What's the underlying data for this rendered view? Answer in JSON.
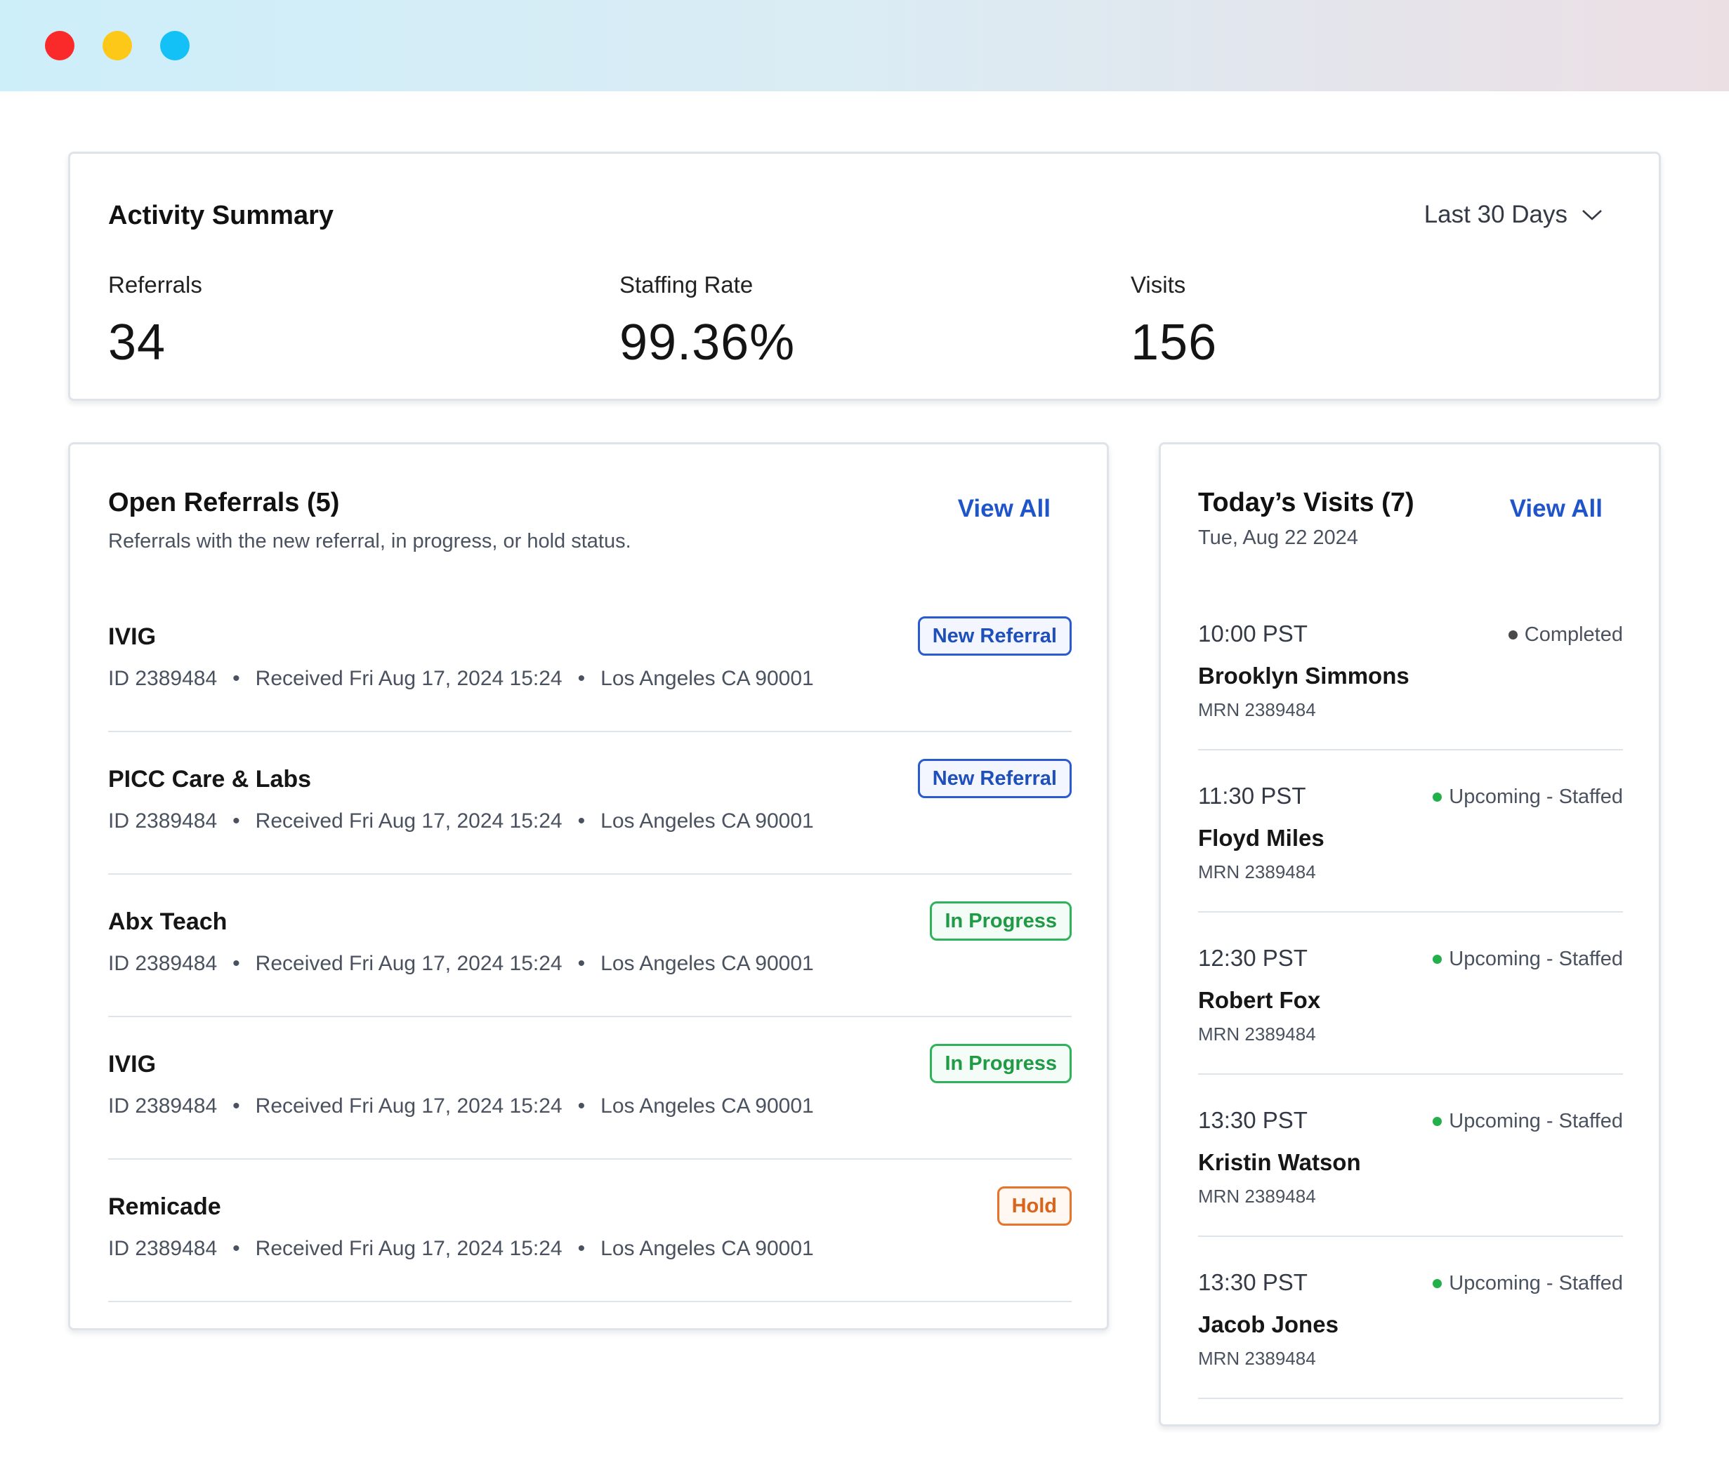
{
  "window": {
    "controls": [
      "close",
      "minimize",
      "maximize"
    ]
  },
  "summary": {
    "title": "Activity Summary",
    "range": "Last 30 Days",
    "metrics": [
      {
        "label": "Referrals",
        "value": "34"
      },
      {
        "label": "Staffing Rate",
        "value": "99.36%"
      },
      {
        "label": "Visits",
        "value": "156"
      }
    ]
  },
  "referrals": {
    "title": "Open Referrals (5)",
    "subtitle": "Referrals with the new referral, in progress, or hold status.",
    "view_all": "View All",
    "items": [
      {
        "name": "IVIG",
        "id": "ID 2389484",
        "received": "Received Fri Aug 17, 2024 15:24",
        "location": "Los Angeles CA 90001",
        "status": "New Referral",
        "status_type": "new"
      },
      {
        "name": "PICC Care & Labs",
        "id": "ID 2389484",
        "received": "Received Fri Aug 17, 2024 15:24",
        "location": "Los Angeles CA 90001",
        "status": "New Referral",
        "status_type": "new"
      },
      {
        "name": "Abx Teach",
        "id": "ID 2389484",
        "received": "Received Fri Aug 17, 2024 15:24",
        "location": "Los Angeles CA 90001",
        "status": "In Progress",
        "status_type": "progress"
      },
      {
        "name": "IVIG",
        "id": "ID 2389484",
        "received": "Received Fri Aug 17, 2024 15:24",
        "location": "Los Angeles CA 90001",
        "status": "In Progress",
        "status_type": "progress"
      },
      {
        "name": "Remicade",
        "id": "ID 2389484",
        "received": "Received Fri Aug 17, 2024 15:24",
        "location": "Los Angeles CA 90001",
        "status": "Hold",
        "status_type": "hold"
      }
    ]
  },
  "visits": {
    "title": "Today’s Visits (7)",
    "date": "Tue, Aug 22 2024",
    "view_all": "View All",
    "items": [
      {
        "time": "10:00 PST",
        "status": "Completed",
        "status_color": "#4a4a4a",
        "name": "Brooklyn Simmons",
        "mrn": "MRN 2389484"
      },
      {
        "time": "11:30 PST",
        "status": "Upcoming - Staffed",
        "status_color": "#22b04b",
        "name": "Floyd Miles",
        "mrn": "MRN 2389484"
      },
      {
        "time": "12:30 PST",
        "status": "Upcoming - Staffed",
        "status_color": "#22b04b",
        "name": "Robert Fox",
        "mrn": "MRN 2389484"
      },
      {
        "time": "13:30 PST",
        "status": "Upcoming - Staffed",
        "status_color": "#22b04b",
        "name": "Kristin Watson",
        "mrn": "MRN 2389484"
      },
      {
        "time": "13:30 PST",
        "status": "Upcoming - Staffed",
        "status_color": "#22b04b",
        "name": "Jacob Jones",
        "mrn": "MRN 2389484"
      }
    ]
  },
  "colors": {
    "accent": "#2055c9",
    "window_close": "#fb2a2a",
    "window_minimize": "#fdc818",
    "window_maximize": "#14c1f7"
  }
}
